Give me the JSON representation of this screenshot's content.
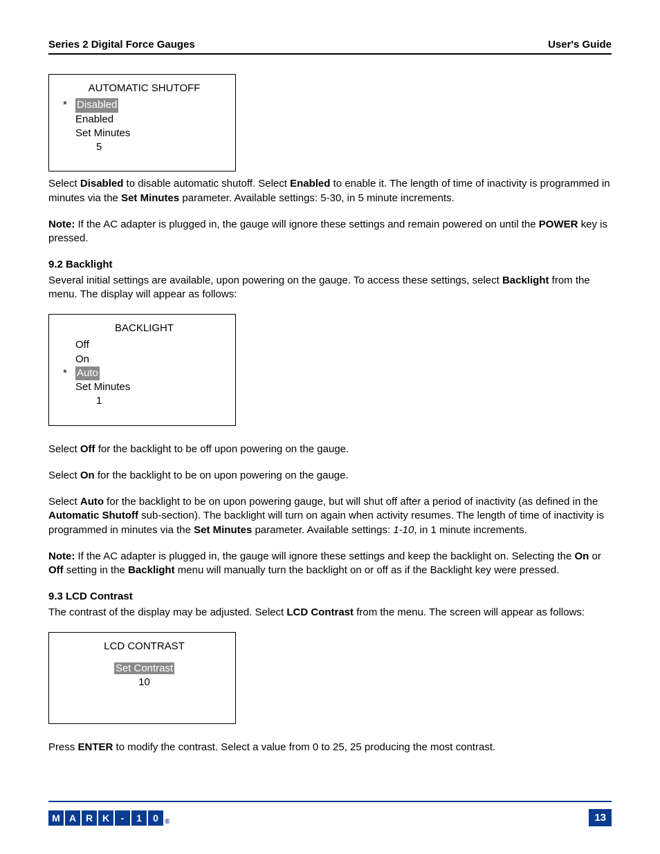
{
  "header": {
    "left": "Series 2 Digital Force Gauges",
    "right": "User's Guide"
  },
  "menu1": {
    "title": "AUTOMATIC SHUTOFF",
    "item1": "Disabled",
    "item2": "Enabled",
    "item3": "Set Minutes",
    "value": "5",
    "marker": "*"
  },
  "para1": {
    "a": "Select ",
    "b": "Disabled",
    "c": " to disable automatic shutoff. Select ",
    "d": "Enabled",
    "e": " to enable it. The length of time of inactivity is programmed in minutes via the ",
    "f": "Set Minutes",
    "g": " parameter. Available settings: 5-30, in 5 minute increments."
  },
  "para2": {
    "a": "Note:",
    "b": " If the AC adapter is plugged in, the gauge will ignore these settings and remain powered on until the ",
    "c": "POWER",
    "d": " key is pressed."
  },
  "section92": {
    "heading": "9.2 Backlight",
    "a": "Several initial settings are available, upon powering on the gauge. To access these settings, select ",
    "b": "Backlight",
    "c": " from the menu. The display will appear as follows:"
  },
  "menu2": {
    "title": "BACKLIGHT",
    "item1": "Off",
    "item2": "On",
    "item3": "Auto",
    "item4": "Set Minutes",
    "value": "1",
    "marker": "*"
  },
  "paraOff": {
    "a": "Select ",
    "b": "Off",
    "c": " for the backlight to be off upon powering on the gauge."
  },
  "paraOn": {
    "a": "Select ",
    "b": "On",
    "c": " for the backlight to be on upon powering on the gauge."
  },
  "paraAuto": {
    "a": "Select ",
    "b": "Auto",
    "c": " for the backlight to be on upon powering gauge, but will shut off after a period of inactivity (as defined in the ",
    "d": "Automatic Shutoff",
    "e": " sub-section). The backlight will turn on again when activity resumes. The length of time of inactivity is programmed in minutes via the ",
    "f": "Set Minutes",
    "g": " parameter. Available settings: ",
    "h": "1-10",
    "i": ", in 1 minute increments."
  },
  "paraNote2": {
    "a": "Note:",
    "b": " If the AC adapter is plugged in, the gauge will ignore these settings and keep the backlight on. Selecting the ",
    "c": "On",
    "d": " or ",
    "e": "Off",
    "f": " setting in the ",
    "g": "Backlight",
    "h": " menu will manually turn the backlight on or off as if the Backlight key were pressed."
  },
  "section93": {
    "heading": "9.3 LCD Contrast",
    "a": "The contrast of the display may be adjusted. Select ",
    "b": "LCD Contrast",
    "c": " from the menu. The screen will appear as follows:"
  },
  "menu3": {
    "title": "LCD CONTRAST",
    "item1": "Set Contrast",
    "value": "10"
  },
  "paraEnter": {
    "a": "Press ",
    "b": "ENTER",
    "c": " to modify the contrast. Select a value from 0 to 25, 25 producing the most contrast."
  },
  "footer": {
    "logo": [
      "M",
      "A",
      "R",
      "K",
      "-",
      "1",
      "0"
    ],
    "reg": "®",
    "page": "13"
  }
}
